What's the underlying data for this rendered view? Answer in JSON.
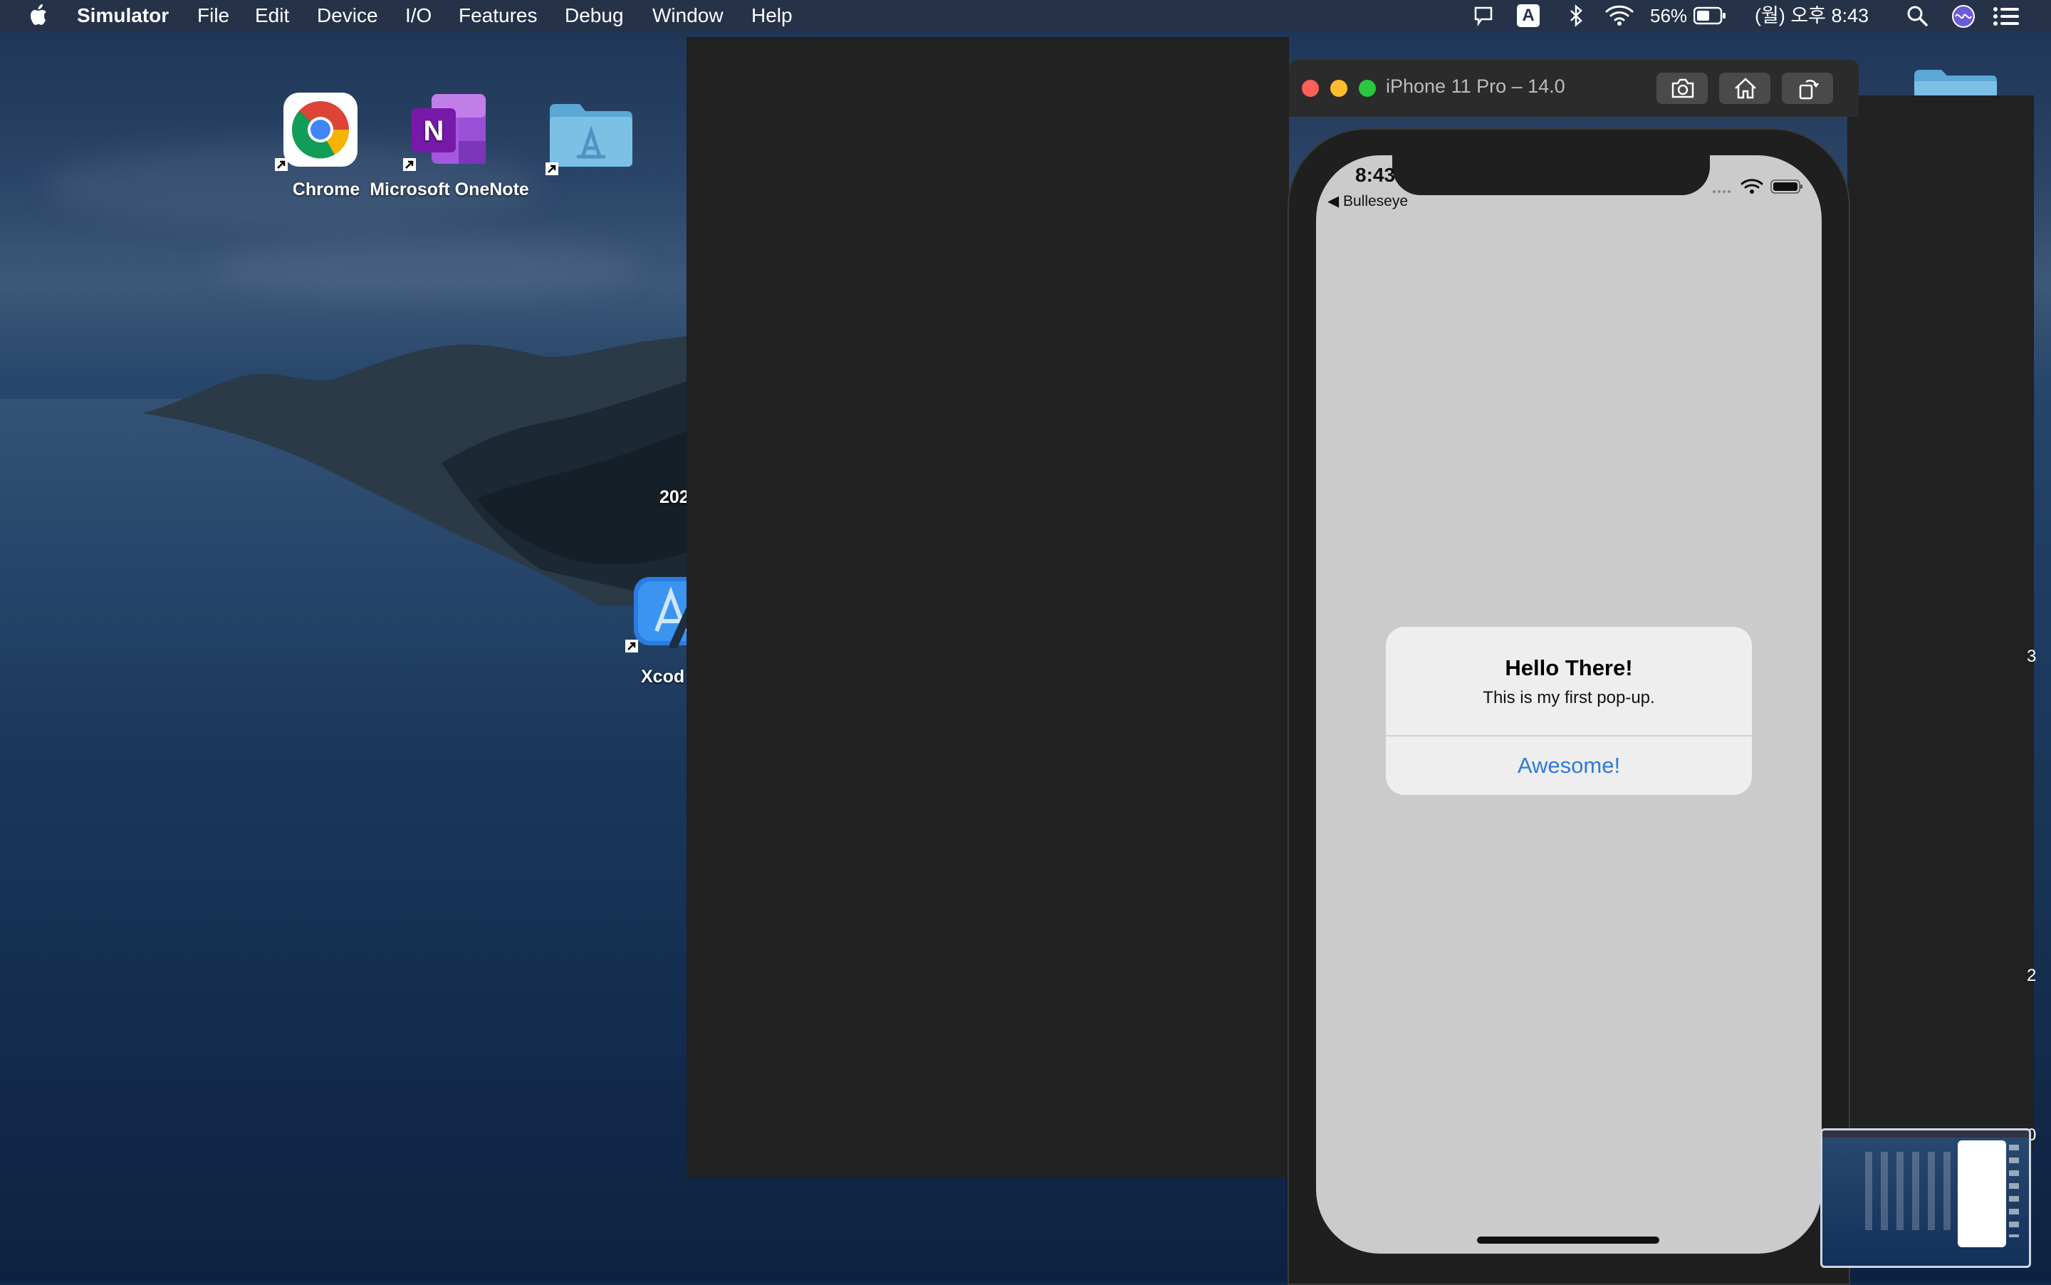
{
  "menubar": {
    "app_name": "Simulator",
    "items": [
      "File",
      "Edit",
      "Device",
      "I/O",
      "Features",
      "Debug",
      "Window",
      "Help"
    ],
    "status": {
      "input_indicator": "A",
      "battery_percent": "56%",
      "clock": "(월) 오후 8:43"
    }
  },
  "desktop": {
    "icons": [
      {
        "label": "Chrome"
      },
      {
        "label": "Microsoft OneNote"
      },
      {
        "label": ""
      }
    ],
    "xcode_label": "Xcod",
    "partial_text": "202"
  },
  "simulator": {
    "window_title": "iPhone 11 Pro – 14.0",
    "status_time": "8:43",
    "back_label": "◀ Bulleseye",
    "alert": {
      "title": "Hello There!",
      "message": "This is my first pop-up.",
      "button": "Awesome!"
    }
  },
  "right_edge_fragments": [
    "3",
    "2",
    "0"
  ],
  "colors": {
    "alert_button": "#2f7ad9",
    "traffic_close": "#fe5f57",
    "traffic_min": "#febc2e",
    "traffic_max": "#28c840"
  }
}
